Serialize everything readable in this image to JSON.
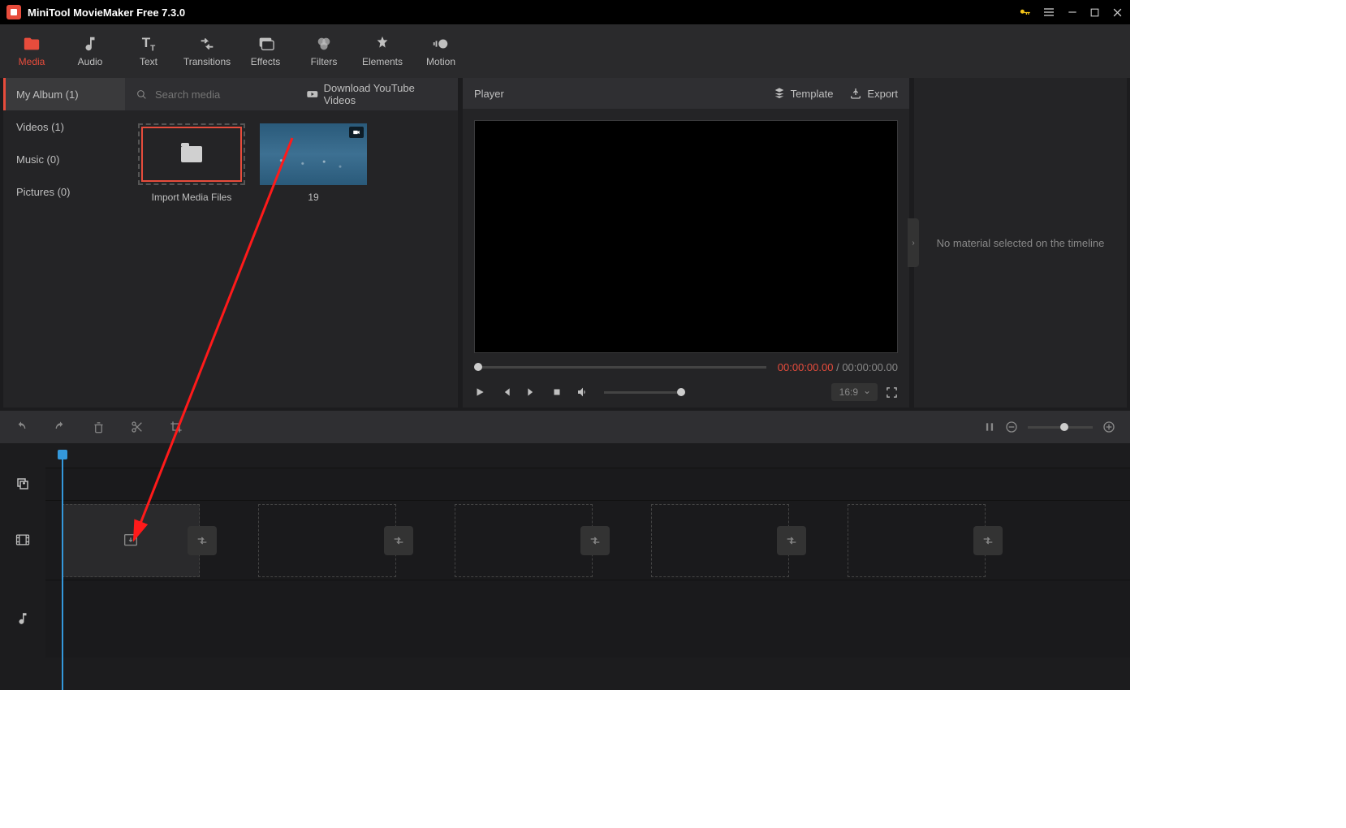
{
  "title": "MiniTool MovieMaker Free 7.3.0",
  "toolbar": [
    {
      "id": "media",
      "label": "Media",
      "active": true
    },
    {
      "id": "audio",
      "label": "Audio"
    },
    {
      "id": "text",
      "label": "Text"
    },
    {
      "id": "transitions",
      "label": "Transitions"
    },
    {
      "id": "effects",
      "label": "Effects"
    },
    {
      "id": "filters",
      "label": "Filters"
    },
    {
      "id": "elements",
      "label": "Elements"
    },
    {
      "id": "motion",
      "label": "Motion"
    }
  ],
  "media": {
    "tabs": [
      {
        "label": "My Album (1)",
        "active": true
      },
      {
        "label": "Videos (1)"
      },
      {
        "label": "Music (0)"
      },
      {
        "label": "Pictures (0)"
      }
    ],
    "search_placeholder": "Search media",
    "youtube_link": "Download YouTube Videos",
    "import_label": "Import Media Files",
    "clips": [
      {
        "name": "19"
      }
    ]
  },
  "player": {
    "title": "Player",
    "template_label": "Template",
    "export_label": "Export",
    "current_time": "00:00:00.00",
    "total_time": "00:00:00.00",
    "aspect_ratio": "16:9"
  },
  "props": {
    "empty_text": "No material selected on the timeline"
  }
}
